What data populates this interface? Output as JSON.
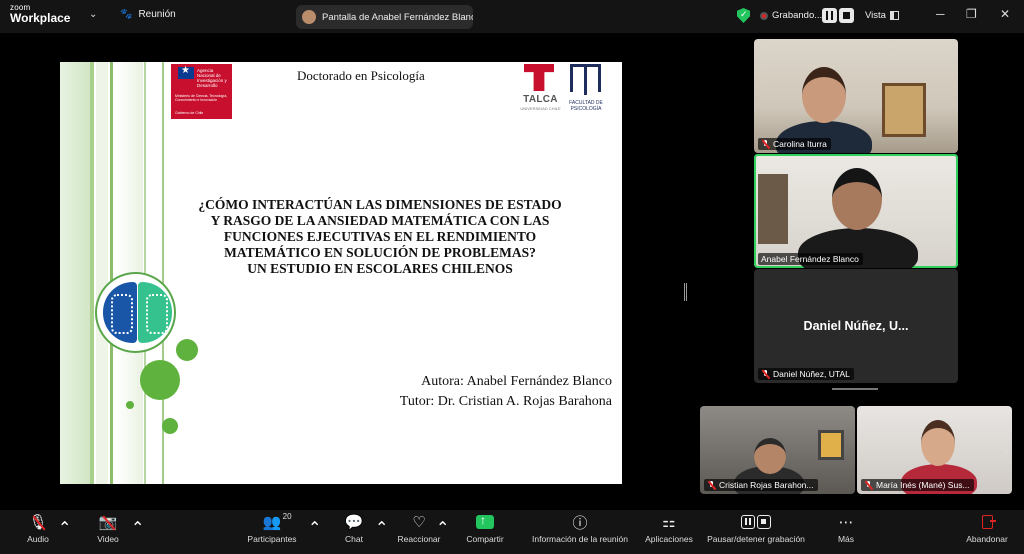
{
  "app": {
    "logo_top": "zoom",
    "logo_bottom": "Workplace",
    "meeting_label": "Reunión"
  },
  "share": {
    "title": "Pantalla de Anabel Fernández Blanco"
  },
  "recording": {
    "label": "Grabando..."
  },
  "view": {
    "label": "Vista"
  },
  "slide": {
    "header": "Doctorado en Psicología",
    "gov_logo": {
      "line1": "Agencia Nacional de Investigación y Desarrollo",
      "line2": "Ministerio de Ciencia, Tecnología, Conocimiento e Innovación",
      "line3": "Gobierno de Chile"
    },
    "talca_logo": {
      "name": "TALCA",
      "sub": "UNIVERSIDAD CHILE"
    },
    "psi_logo": {
      "name": "FACULTAD DE PSICOLOGÍA"
    },
    "title_lines": [
      "¿CÓMO INTERACTÚAN LAS DIMENSIONES DE ESTADO",
      "Y RASGO DE LA ANSIEDAD MATEMÁTICA CON LAS",
      "FUNCIONES EJECUTIVAS EN EL RENDIMIENTO",
      "MATEMÁTICO EN SOLUCIÓN DE PROBLEMAS?",
      "UN ESTUDIO EN ESCOLARES CHILENOS"
    ],
    "author": "Autora: Anabel Fernández Blanco",
    "tutor": "Tutor: Dr. Cristian A. Rojas Barahona"
  },
  "participants_panel": [
    {
      "name": "Carolina Iturra"
    },
    {
      "name": "Anabel Fernández Blanco"
    },
    {
      "name": "Daniel Núñez, UTAL",
      "display_name": "Daniel Núñez, U..."
    }
  ],
  "strip_participants": [
    {
      "name": "Cristian Rojas Barahon..."
    },
    {
      "name": "María Inés (Mané) Sus..."
    }
  ],
  "toolbar": {
    "audio": "Audio",
    "video": "Video",
    "participants": "Participantes",
    "participants_count": "20",
    "chat": "Chat",
    "reactions": "Reaccionar",
    "share": "Compartir",
    "info": "Información de la reunión",
    "apps": "Aplicaciones",
    "pause_record": "Pausar/detener grabación",
    "more": "Más",
    "leave": "Abandonar"
  },
  "colors": {
    "active_speaker": "#2fd05b",
    "record": "#e02424",
    "share_green": "#23c55e",
    "slide_green": "#5fb23e"
  }
}
